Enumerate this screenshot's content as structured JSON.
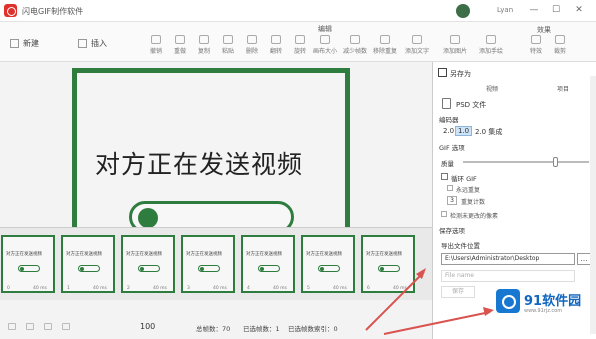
{
  "window": {
    "title": "闪电GIF制作软件",
    "user": "Lyan",
    "minimize": "—",
    "maximize": "☐",
    "close": "✕"
  },
  "ribbon": {
    "edit_group": "编辑",
    "effect_group": "效果",
    "new_label": "新建",
    "insert_label": "插入",
    "tools": [
      "撤销",
      "重做",
      "复制",
      "粘贴",
      "删除",
      "翻转",
      "旋转",
      "画布大小",
      "减少帧数",
      "移除重复",
      "添加文字",
      "添加图片",
      "添加手绘"
    ],
    "effect_tools": [
      "特效",
      "裁剪"
    ]
  },
  "preview": {
    "text": "对方正在发送视频"
  },
  "frames": [
    {
      "label": "对方正在发送视频",
      "index": "0",
      "delay": "40 ms"
    },
    {
      "label": "对方正在发送视频",
      "index": "1",
      "delay": "40 ms"
    },
    {
      "label": "对方正在发送视频",
      "index": "2",
      "delay": "40 ms"
    },
    {
      "label": "对方正在发送视频",
      "index": "3",
      "delay": "40 ms"
    },
    {
      "label": "对方正在发送视频",
      "index": "4",
      "delay": "40 ms"
    },
    {
      "label": "对方正在发送视频",
      "index": "5",
      "delay": "40 ms"
    },
    {
      "label": "对方正在发送视频",
      "index": "6",
      "delay": "40 ms"
    }
  ],
  "status": {
    "zoom": "100",
    "total": "总帧数：70",
    "selected": "已选帧数：1",
    "selected_index": "已选帧数索引：0"
  },
  "panel": {
    "save_as": "另存为",
    "format_a": "视频",
    "format_b": "项目",
    "psd": "PSD 文件",
    "encoder_label": "编码器",
    "encoder_v1": "2.0",
    "encoder_v2": "1.0",
    "encoder_text": "2.0 集成",
    "gif_section": "GIF 选项",
    "quality": "质量",
    "loop": "循环 GIF",
    "repeat_forever": "永远重复",
    "repeat_count_value": "3",
    "repeat_count_label": "重复计数",
    "transparency": "检测未更改的像素",
    "save_options": "保存选项",
    "export_location": "导出文件位置",
    "path": "E:\\Users\\Administrator\\Desktop",
    "browse": "…",
    "filename": "File name",
    "save_button": "保存"
  },
  "watermark": {
    "brand": "91软件园",
    "url": "www.91rjz.com"
  }
}
